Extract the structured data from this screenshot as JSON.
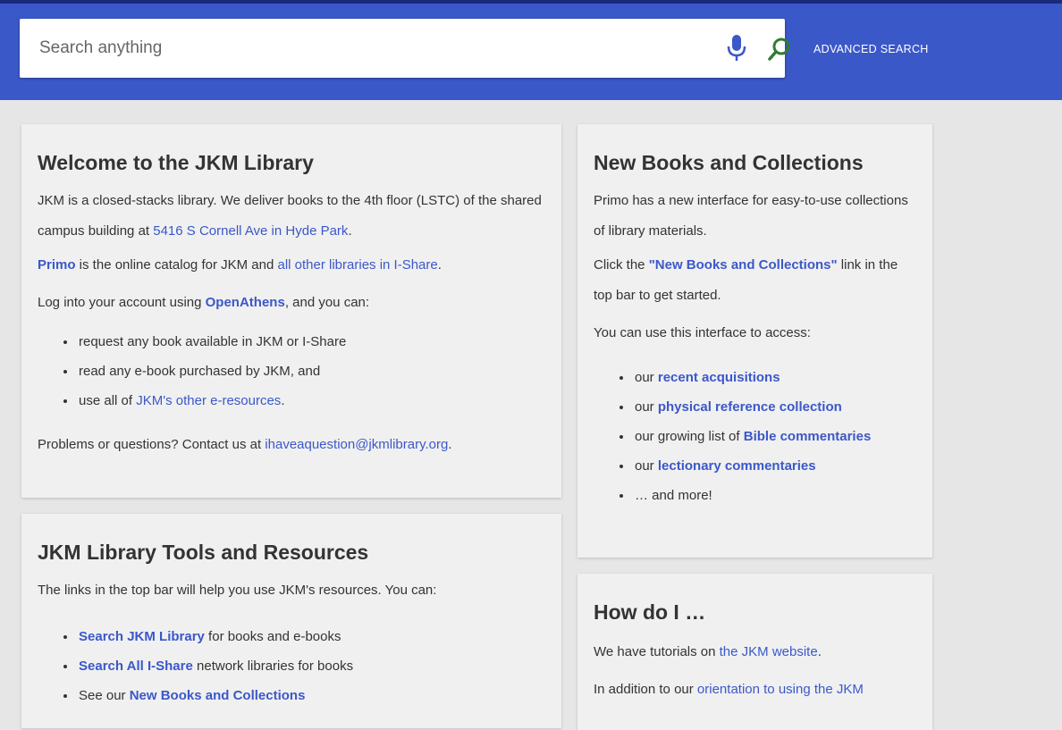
{
  "search": {
    "placeholder": "Search anything",
    "advanced_label": "ADVANCED SEARCH"
  },
  "welcome": {
    "title": "Welcome to the JKM Library",
    "p1_text": "JKM is a closed-stacks library. We deliver books to the 4th floor (LSTC) of the shared campus building at ",
    "p1_link": "5416 S Cornell Ave in Hyde Park",
    "p1_end": ".",
    "p2_link1": "Primo",
    "p2_text": " is the online catalog for JKM and ",
    "p2_link2": "all other libraries in I-Share",
    "p2_end": ".",
    "p3_text": "Log into your account using ",
    "p3_link": "OpenAthens",
    "p3_end": ", and you can:",
    "list": {
      "item1": "request any book available in JKM or I-Share",
      "item2": "read any e-book purchased by JKM, and",
      "item3_text": "use all of ",
      "item3_link": "JKM's other e-resources",
      "item3_end": "."
    },
    "p4_text": "Problems or questions? Contact us at ",
    "p4_link": "ihaveaquestion@jkmlibrary.org",
    "p4_end": "."
  },
  "tools": {
    "title": "JKM Library Tools and Resources",
    "intro": "The links in the top bar will help you use JKM's resources. You can:",
    "list": {
      "item1_link": "Search JKM Library",
      "item1_text": " for books and e-books",
      "item2_link": "Search All I-Share",
      "item2_text": " network libraries for books",
      "item3_text": "See our ",
      "item3_link": "New Books and Collections"
    }
  },
  "newbooks": {
    "title": "New Books and Collections",
    "p1": "Primo has a new interface for easy-to-use collections of library materials.",
    "p2_text": "Click the ",
    "p2_link": "\"New Books and Collections\"",
    "p2_end": " link in the top bar to get started.",
    "p3": "You can use this interface to access:",
    "list": {
      "item1_text": "our ",
      "item1_link": "recent acquisitions",
      "item2_text": "our ",
      "item2_link": "physical reference collection",
      "item3_text": "our growing list of ",
      "item3_link": "Bible commentaries",
      "item4_text": "our ",
      "item4_link": "lectionary commentaries",
      "item5": "… and more!"
    }
  },
  "howdoi": {
    "title": "How do I …",
    "p1_text": "We have tutorials on ",
    "p1_link": "the JKM website",
    "p1_end": ".",
    "p2_text": "In addition to our ",
    "p2_link": "orientation to using the JKM"
  }
}
